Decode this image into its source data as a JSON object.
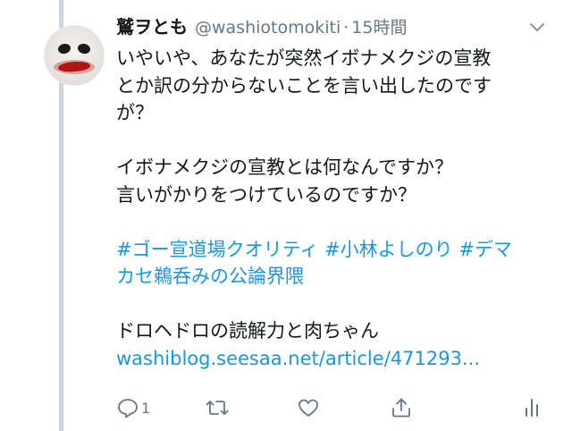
{
  "tweet": {
    "display_name": "鷲ヲとも",
    "handle": "@washiotomokiti",
    "separator": "·",
    "time": "15時間",
    "text": {
      "line1": "いやいや、あなたが突然イボナメクジの宣教",
      "line2": "とか訳の分からないことを言い出したのです",
      "line3": "が？",
      "line4": "イボナメクジの宣教とは何なんですか？",
      "line5": "言いがかりをつけているのですか？",
      "hashtag1": "#ゴー宣道場クオリティ",
      "hashtag2": "#小林よしのり",
      "hashtag3_part1": "#デマ",
      "hashtag3_part2": "カセ鵜呑みの公論界隈",
      "line8": "ドロヘドロの読解力と肉ちゃん",
      "link": "washiblog.seesaa.net/article/471293..."
    },
    "actions": {
      "reply_count": "1"
    }
  },
  "icons": {
    "menu": "chevron-down-icon",
    "reply": "reply-icon",
    "retweet": "retweet-icon",
    "like": "heart-icon",
    "share": "share-icon",
    "analytics": "analytics-icon"
  },
  "colors": {
    "text": "#14171a",
    "secondary": "#657786",
    "link": "#1b95e0",
    "thread_line": "#ccd6dd"
  }
}
